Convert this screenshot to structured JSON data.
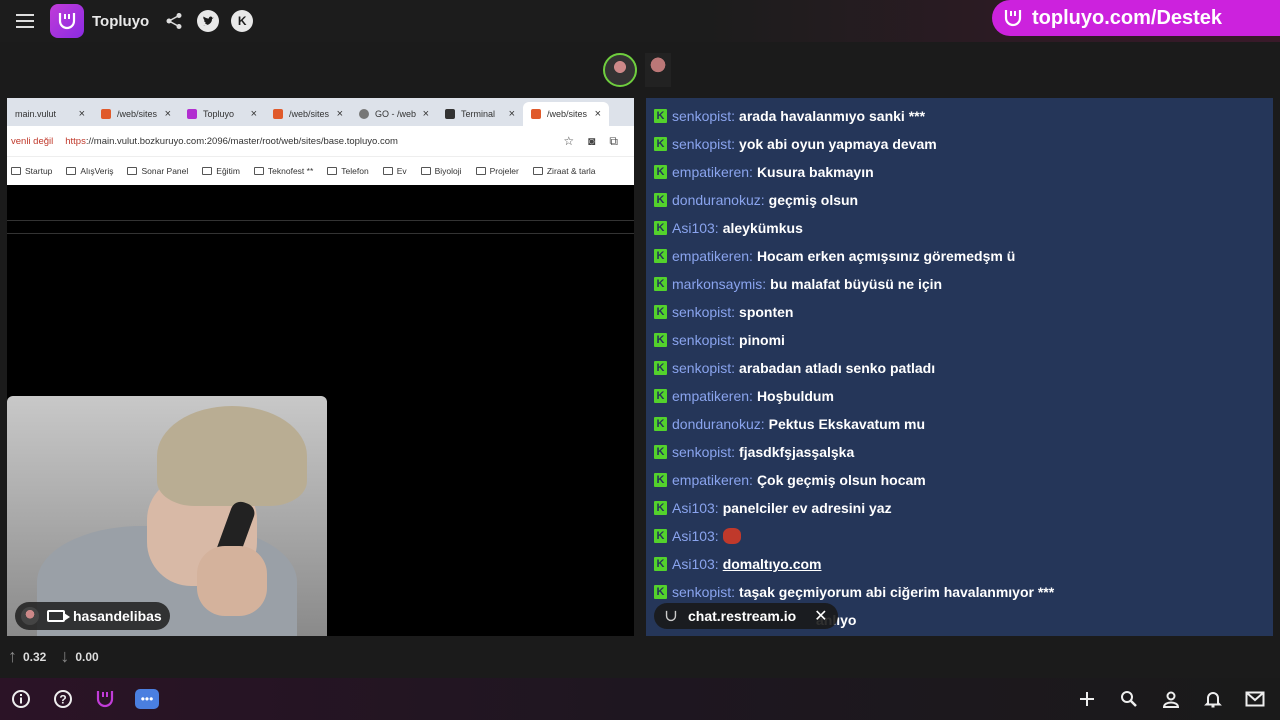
{
  "header": {
    "brand": "Topluyo",
    "icons": [
      "menu-icon",
      "share-icon",
      "twitter-icon",
      "kick-icon"
    ],
    "promo_text": "topluyo.com/Destek"
  },
  "browser": {
    "tabs": [
      {
        "label": "main.vulut",
        "active": false
      },
      {
        "label": "/web/sites",
        "active": false
      },
      {
        "label": "Topluyo",
        "active": false
      },
      {
        "label": "/web/sites",
        "active": false
      },
      {
        "label": "GO - /web",
        "active": false
      },
      {
        "label": "Terminal",
        "active": false
      },
      {
        "label": "/web/sites",
        "active": true
      }
    ],
    "security_warning": "venli değil",
    "url_protocol": "https",
    "url_rest": "://main.vulut.bozkuruyo.com:2096/master/root/web/sites/base.topluyo.com",
    "bookmarks": [
      "Startup",
      "AlışVeriş",
      "Sonar Panel",
      "Eğitim",
      "Teknofest **",
      "Telefon",
      "Ev",
      "Biyoloji",
      "Projeler",
      "Ziraat & tarla"
    ]
  },
  "camera": {
    "username": "hasandelibas"
  },
  "chat": {
    "messages": [
      {
        "user": "senkopist:",
        "text": "arada havalanmıyo sanki ***"
      },
      {
        "user": "senkopist:",
        "text": "yok abi oyun yapmaya devam"
      },
      {
        "user": "empatikeren:",
        "text": "Kusura bakmayın"
      },
      {
        "user": "donduranokuz:",
        "text": "geçmiş olsun"
      },
      {
        "user": "Asi103:",
        "text": "aleykümkus"
      },
      {
        "user": "empatikeren:",
        "text": "Hocam erken açmışsınız göremedşm ü"
      },
      {
        "user": "markonsaymis:",
        "text": "bu malafat büyüsü ne için"
      },
      {
        "user": "senkopist:",
        "text": "sponten"
      },
      {
        "user": "senkopist:",
        "text": "pinomi"
      },
      {
        "user": "senkopist:",
        "text": "arabadan atladı senko patladı"
      },
      {
        "user": "empatikeren:",
        "text": "Hoşbuldum"
      },
      {
        "user": "donduranokuz:",
        "text": "Pektus Ekskavatum mu"
      },
      {
        "user": "senkopist:",
        "text": "fjasdkfşjasşalşka"
      },
      {
        "user": "empatikeren:",
        "text": "Çok geçmiş olsun hocam"
      },
      {
        "user": "Asi103:",
        "text": "panelciler ev adresini yaz"
      },
      {
        "user": "Asi103:",
        "text": ""
      },
      {
        "user": "Asi103:",
        "text": "domaltıyo.com"
      },
      {
        "user": "senkopist:",
        "text": "taşak geçmiyorum abi ciğerim havalanmıyor ***"
      },
      {
        "user": "",
        "text": "anlıyo"
      }
    ],
    "source_badge": "chat.restream.io"
  },
  "stats": {
    "up": "0.32",
    "down": "0.00"
  },
  "footer": {
    "left_icons": [
      "info-icon",
      "help-icon",
      "topluyo-icon",
      "chat-icon"
    ],
    "right_icons": [
      "plus-icon",
      "search-icon",
      "user-icon",
      "bell-icon",
      "mail-icon"
    ]
  }
}
